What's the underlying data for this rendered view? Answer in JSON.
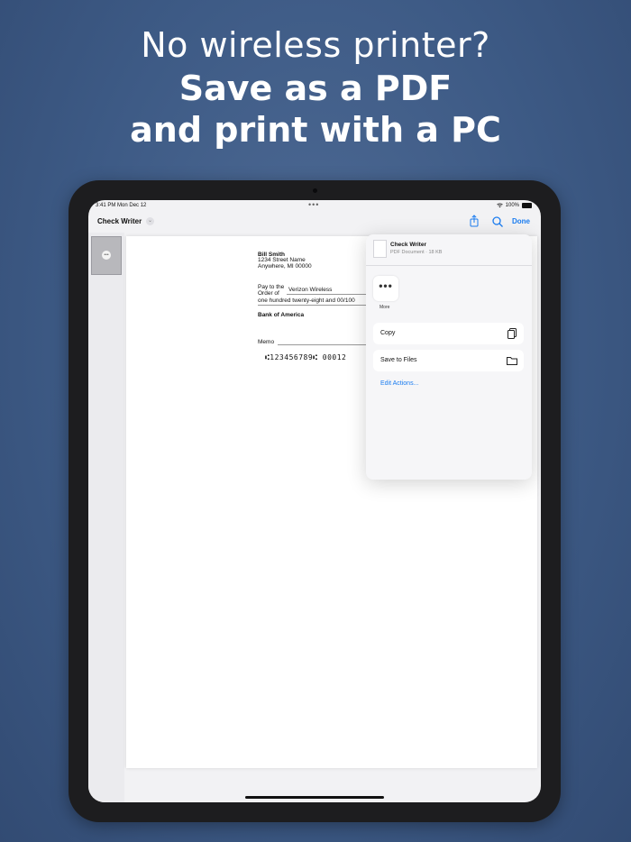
{
  "headline": {
    "line1": "No wireless printer?",
    "line2": "Save as a PDF",
    "line3": "and print with a PC"
  },
  "status_bar": {
    "time": "3:41 PM",
    "date": "Mon Dec 12",
    "battery": "100%"
  },
  "nav": {
    "title": "Check Writer",
    "done_label": "Done"
  },
  "check": {
    "name": "Bill Smith",
    "address1": "1234 Street Name",
    "address2": "Anywhere, MI 00000",
    "pay_to_label": "Pay to the\nOrder of",
    "payee": "Verizon Wireless",
    "amount_words": "one hundred twenty-eight and 00/100",
    "bank": "Bank of America",
    "memo_label": "Memo",
    "micr": "⑆123456789⑆ 00012"
  },
  "share_sheet": {
    "title": "Check Writer",
    "subtitle": "PDF Document · 18 KB",
    "more_label": "More",
    "actions": [
      {
        "label": "Copy",
        "icon": "copy-icon"
      },
      {
        "label": "Save to Files",
        "icon": "folder-icon"
      }
    ],
    "edit_actions_label": "Edit Actions..."
  },
  "colors": {
    "background": "#3d5a85",
    "accent": "#1a7cf0"
  }
}
